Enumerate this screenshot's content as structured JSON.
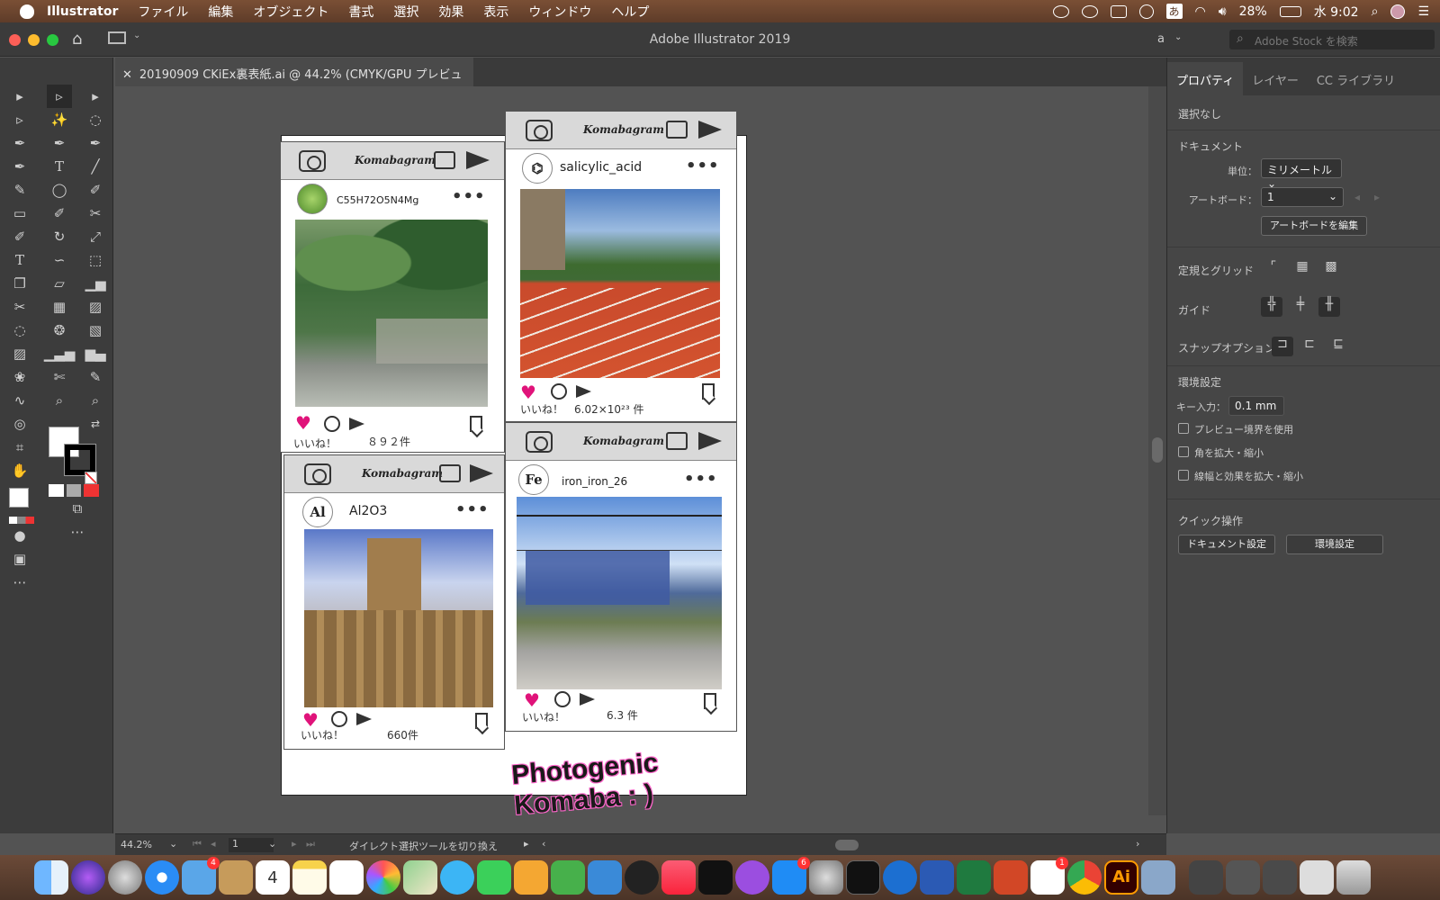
{
  "menubar": {
    "app": "Illustrator",
    "items": [
      "ファイル",
      "編集",
      "オブジェクト",
      "書式",
      "選択",
      "効果",
      "表示",
      "ウィンドウ",
      "ヘルプ"
    ],
    "battery": "28%",
    "clock": "水 9:02",
    "ime": "あ"
  },
  "window": {
    "title": "Adobe Illustrator 2019",
    "workspace": "a",
    "stock_placeholder": "Adobe Stock を検索"
  },
  "document": {
    "tab": "20190909 CKiEx裏表紙.ai @ 44.2% (CMYK/GPU プレビュー)"
  },
  "cards": [
    {
      "brand": "Komabagram",
      "user": "C55H72O5N4Mg",
      "likes": "いいね！",
      "count": "８９２件"
    },
    {
      "brand": "Komabagram",
      "user": "salicylic_acid",
      "likes": "いいね！",
      "count": "6.02×10²³ 件"
    },
    {
      "brand": "Komabagram",
      "user": "Al2O3",
      "avatar": "Al",
      "likes": "いいね！",
      "count": "660件"
    },
    {
      "brand": "Komabagram",
      "user": "iron_iron_26",
      "avatar": "Fe",
      "likes": "いいね！",
      "count": "6.3 件"
    }
  ],
  "slogan": "Photogenic Komaba : )",
  "panel": {
    "tabs": [
      "プロパティ",
      "レイヤー",
      "CC ライブラリ"
    ],
    "selection": "選択なし",
    "document_title": "ドキュメント",
    "unit_label": "単位：",
    "unit_value": "ミリメートル",
    "artboard_label": "アートボード：",
    "artboard_value": "1",
    "edit_artboard": "アートボードを編集",
    "rulers_grid": "定規とグリッド",
    "guides": "ガイド",
    "snap": "スナップオプション",
    "prefs": "環境設定",
    "key_label": "キー入力：",
    "key_value": "0.1 mm",
    "chk1": "プレビュー境界を使用",
    "chk2": "角を拡大・縮小",
    "chk3": "線幅と効果を拡大・縮小",
    "quick": "クイック操作",
    "doc_settings": "ドキュメント設定",
    "env_settings": "環境設定"
  },
  "status": {
    "zoom": "44.2%",
    "artboard": "1",
    "tool_hint": "ダイレクト選択ツールを切り換え"
  },
  "dock_badges": {
    "mail": "4",
    "calendar": "4",
    "appstore": "6",
    "slack": "1"
  }
}
